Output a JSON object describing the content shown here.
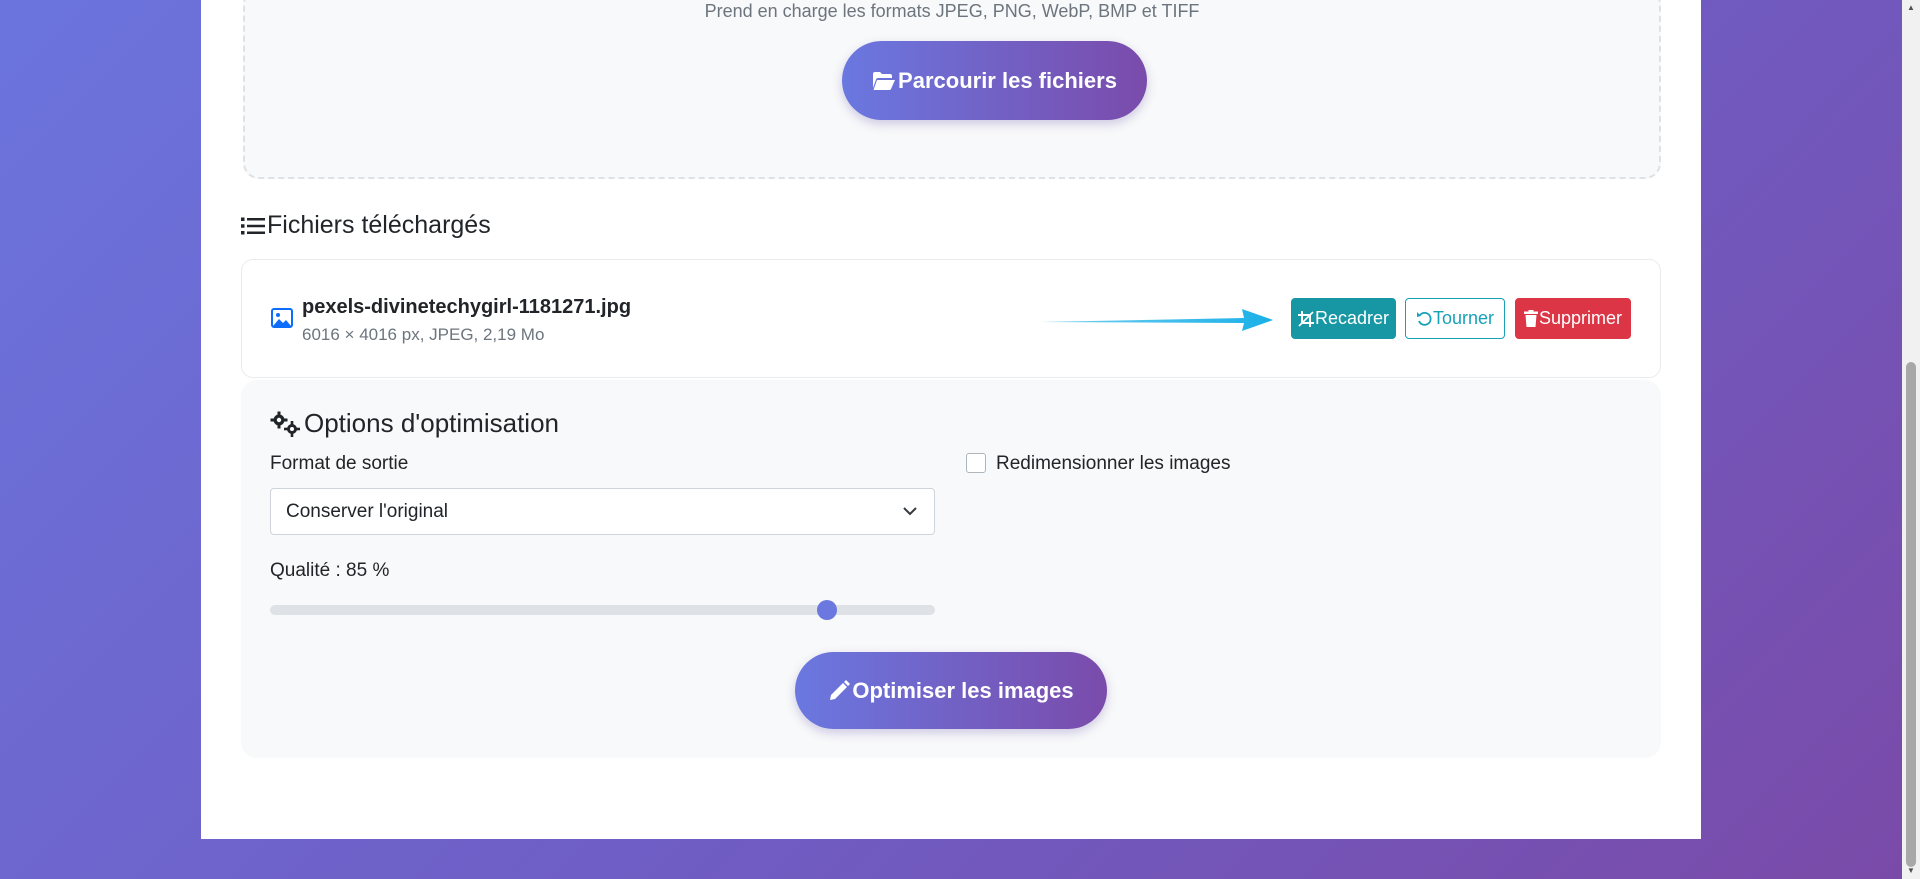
{
  "upload": {
    "supported_formats": "Prend en charge les formats JPEG, PNG, WebP, BMP et TIFF",
    "browse_label": "Parcourir les fichiers"
  },
  "files_section": {
    "title": "Fichiers téléchargés",
    "files": [
      {
        "name": "pexels-divinetechygirl-1181271.jpg",
        "meta": "6016 × 4016 px, JPEG, 2,19 Mo",
        "actions": {
          "crop": "Recadrer",
          "rotate": "Tourner",
          "delete": "Supprimer"
        }
      }
    ]
  },
  "options": {
    "title": "Options d'optimisation",
    "format_label": "Format de sortie",
    "format_value": "Conserver l'original",
    "resize_label": "Redimensionner les images",
    "resize_checked": false,
    "quality_label": "Qualité : 85 %",
    "quality_value": 85,
    "quality_min": 1,
    "quality_max": 100
  },
  "optimize_label": "Optimiser les images",
  "colors": {
    "gradient_start": "#6a78e0",
    "gradient_end": "#7a4bab",
    "crop_button": "#1797a3",
    "rotate_button": "#17a2b8",
    "delete_button": "#dc3545",
    "annotation_arrow": "#1ab0e8"
  },
  "icons": {
    "browse": "folder-open-icon",
    "files_title": "list-icon",
    "file": "image-icon",
    "crop": "crop-icon",
    "rotate": "rotate-icon",
    "delete": "trash-icon",
    "options_title": "gears-icon",
    "optimize": "pencil-icon",
    "select": "chevron-down-icon"
  }
}
